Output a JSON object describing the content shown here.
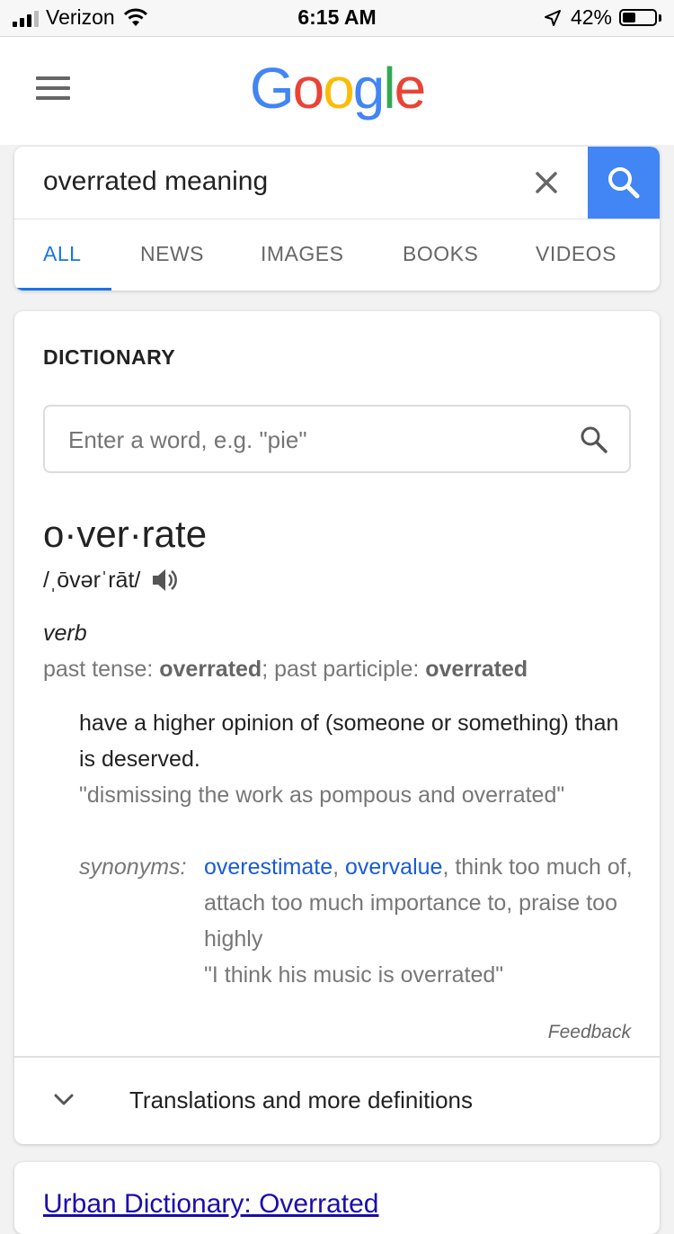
{
  "status_bar": {
    "carrier": "Verizon",
    "time": "6:15 AM",
    "battery_percent": "42%",
    "battery_level": 0.42
  },
  "header": {
    "logo_letters": [
      {
        "char": "G",
        "color": "#4285f4"
      },
      {
        "char": "o",
        "color": "#ea4335"
      },
      {
        "char": "o",
        "color": "#fbbc05"
      },
      {
        "char": "g",
        "color": "#4285f4"
      },
      {
        "char": "l",
        "color": "#34a853"
      },
      {
        "char": "e",
        "color": "#ea4335"
      }
    ]
  },
  "search": {
    "query": "overrated meaning",
    "clear_icon": "close-icon",
    "search_icon": "search-icon"
  },
  "tabs": [
    {
      "label": "ALL",
      "active": true
    },
    {
      "label": "NEWS",
      "active": false
    },
    {
      "label": "IMAGES",
      "active": false
    },
    {
      "label": "BOOKS",
      "active": false
    },
    {
      "label": "VIDEOS",
      "active": false
    }
  ],
  "dictionary": {
    "title": "DICTIONARY",
    "input_placeholder": "Enter a word, e.g. \"pie\"",
    "headword": "o·ver·rate",
    "phonetic": "/ˌōvərˈrāt/",
    "part_of_speech": "verb",
    "forms_past_label": "past tense: ",
    "forms_past_value": "overrated",
    "forms_participle_label": "; past participle: ",
    "forms_participle_value": "overrated",
    "definition": "have a higher opinion of (someone or something) than is deserved.",
    "example": "\"dismissing the work as pompous and overrated\"",
    "synonyms_label": "synonyms:",
    "synonym_links": [
      "overestimate",
      "overvalue"
    ],
    "synonyms_rest": ", think too much of, attach too much importance to, praise too highly",
    "synonym_example": "\"I think his music is overrated\"",
    "feedback": "Feedback",
    "more_label": "Translations and more definitions"
  },
  "next_result": {
    "title": "Urban Dictionary: Overrated"
  },
  "colors": {
    "accent": "#1a73e8",
    "search_button": "#4285f4",
    "link": "#1a5bd6"
  }
}
